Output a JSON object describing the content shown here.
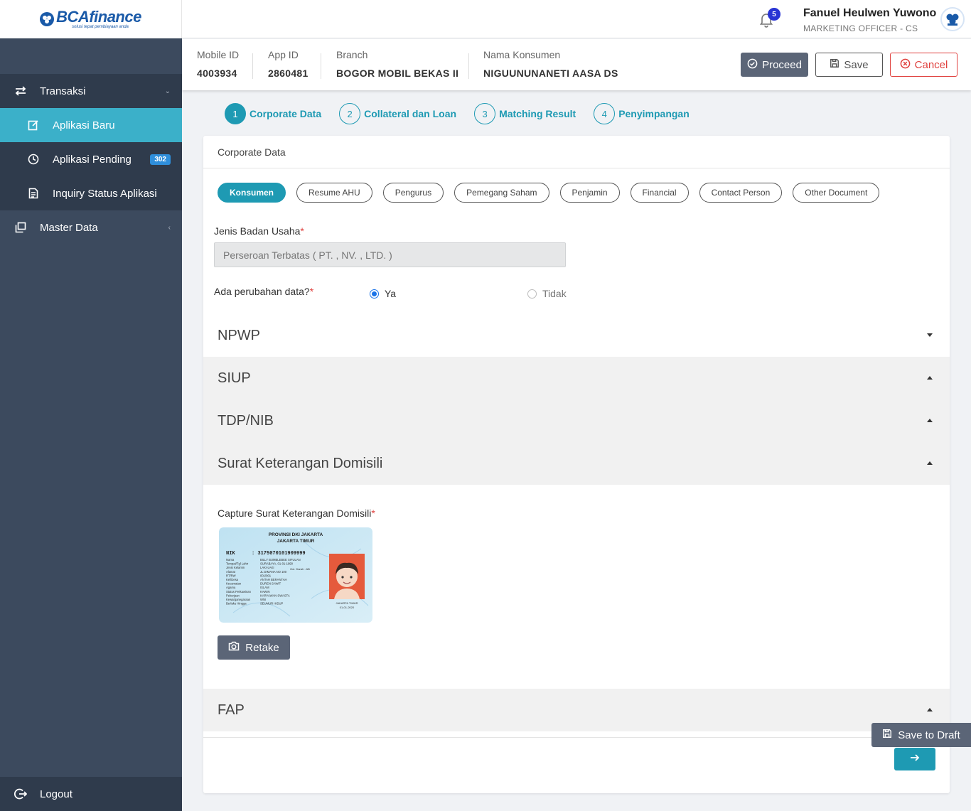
{
  "brand": {
    "name": "BCAfinance",
    "tagline": "solusi tepat pembiayaan anda"
  },
  "sidebar": {
    "items": [
      {
        "label": "Transaksi",
        "icon": "swap-icon"
      },
      {
        "label": "Aplikasi Baru",
        "icon": "edit-icon"
      },
      {
        "label": "Aplikasi Pending",
        "icon": "clock-icon",
        "badge": "302"
      },
      {
        "label": "Inquiry Status Aplikasi",
        "icon": "document-icon"
      },
      {
        "label": "Master Data",
        "icon": "copy-icon"
      }
    ],
    "logout": "Logout"
  },
  "topbar": {
    "notifications": "5",
    "user_name": "Fanuel Heulwen Yuwono",
    "user_role": "MARKETING OFFICER - CS"
  },
  "info": {
    "mobile_id_label": "Mobile ID",
    "mobile_id": "4003934",
    "app_id_label": "App ID",
    "app_id": "2860481",
    "branch_label": "Branch",
    "branch": "BOGOR MOBIL BEKAS II",
    "konsumen_label": "Nama Konsumen",
    "konsumen": "NIGUUNUNANETI AASA DS"
  },
  "actions": {
    "proceed": "Proceed",
    "save": "Save",
    "cancel": "Cancel"
  },
  "steps": [
    {
      "num": "1",
      "label": "Corporate Data"
    },
    {
      "num": "2",
      "label": "Collateral dan Loan"
    },
    {
      "num": "3",
      "label": "Matching Result"
    },
    {
      "num": "4",
      "label": "Penyimpangan"
    }
  ],
  "card": {
    "title": "Corporate Data",
    "chips": [
      "Konsumen",
      "Resume AHU",
      "Pengurus",
      "Pemegang Saham",
      "Penjamin",
      "Financial",
      "Contact Person",
      "Other Document"
    ],
    "jenis_label": "Jenis Badan Usaha",
    "jenis_value": "Perseroan Terbatas ( PT. , NV. , LTD. )",
    "perubahan_label": "Ada perubahan data?",
    "radio_yes": "Ya",
    "radio_no": "Tidak",
    "sections": [
      "NPWP",
      "SIUP",
      "TDP/NIB",
      "Surat Keterangan Domisili",
      "FAP"
    ],
    "capture_label": "Capture Surat Keterangan Domisili",
    "retake": "Retake",
    "save_draft": "Save to Draft"
  },
  "ktp": {
    "province": "PROVINSI DKI JAKARTA",
    "city": "JAKARTA TIMUR",
    "nik_label": "NIK",
    "nik": ": 3175070101909999",
    "rows": [
      [
        "Nama",
        "BILLY BUMBLEBEE SIFULAN"
      ],
      [
        "Tempat/Tgl Lahir",
        "SURABAYA, 01-01-1990"
      ],
      [
        "Jenis Kelamin",
        "LAKI-LAKI"
      ],
      [
        "Alamat",
        "JL DIMANA NO 100"
      ],
      [
        "RT/RW",
        "001/001"
      ],
      [
        "Kel/Desa",
        "ANTAH BERANTAH"
      ],
      [
        "Kecamatan",
        "DUREN SAWIT"
      ],
      [
        "Agama",
        "ISLAM"
      ],
      [
        "Status Perkawinan",
        "KAWIN"
      ],
      [
        "Pekerjaan",
        "KARYAWAN SWASTA"
      ],
      [
        "Kewarganegaraan",
        "WNI"
      ],
      [
        "Berlaku Hingga",
        "SEUMUR HIDUP"
      ]
    ],
    "blood": "Gol. Darah : AB",
    "sign_city": "JAKARTA TIMUR",
    "sign_date": "01-01-2020"
  }
}
